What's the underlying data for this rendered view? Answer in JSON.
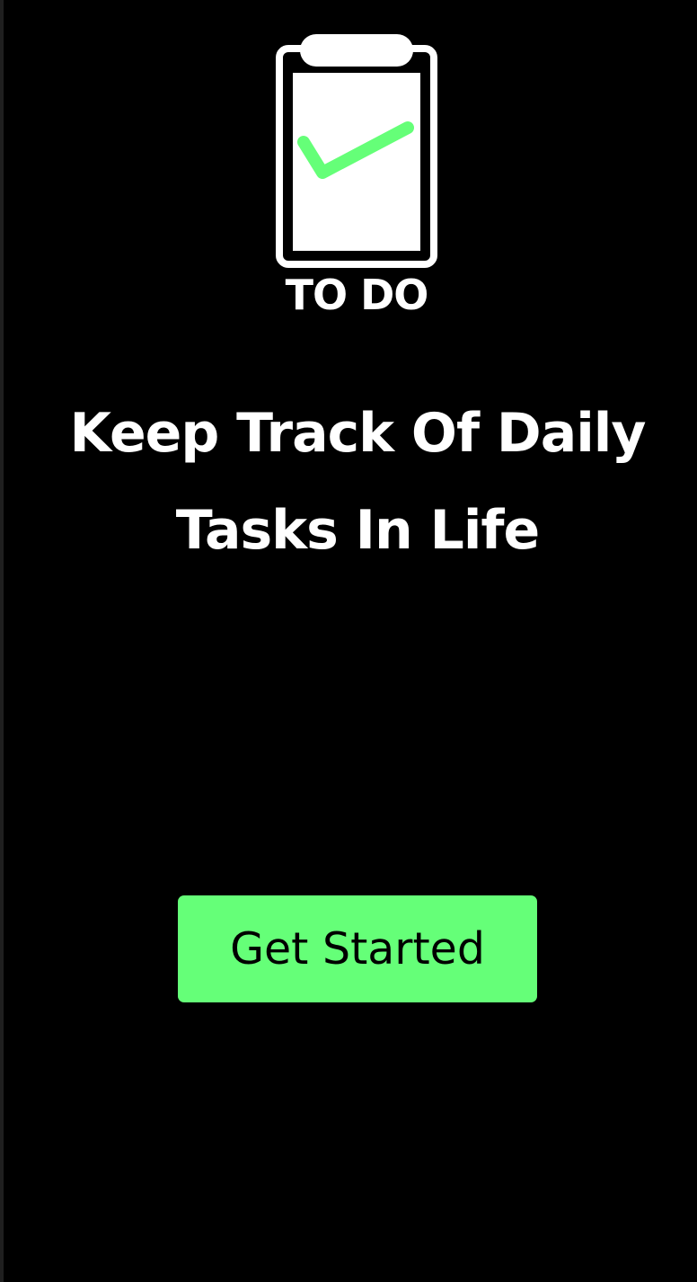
{
  "logo": {
    "icon": "clipboard-check-icon",
    "text": "TO DO"
  },
  "headline": "Keep Track Of Daily Tasks In Life",
  "cta": {
    "label": "Get Started"
  },
  "colors": {
    "background": "#000000",
    "accent": "#65ff78",
    "text": "#ffffff"
  }
}
